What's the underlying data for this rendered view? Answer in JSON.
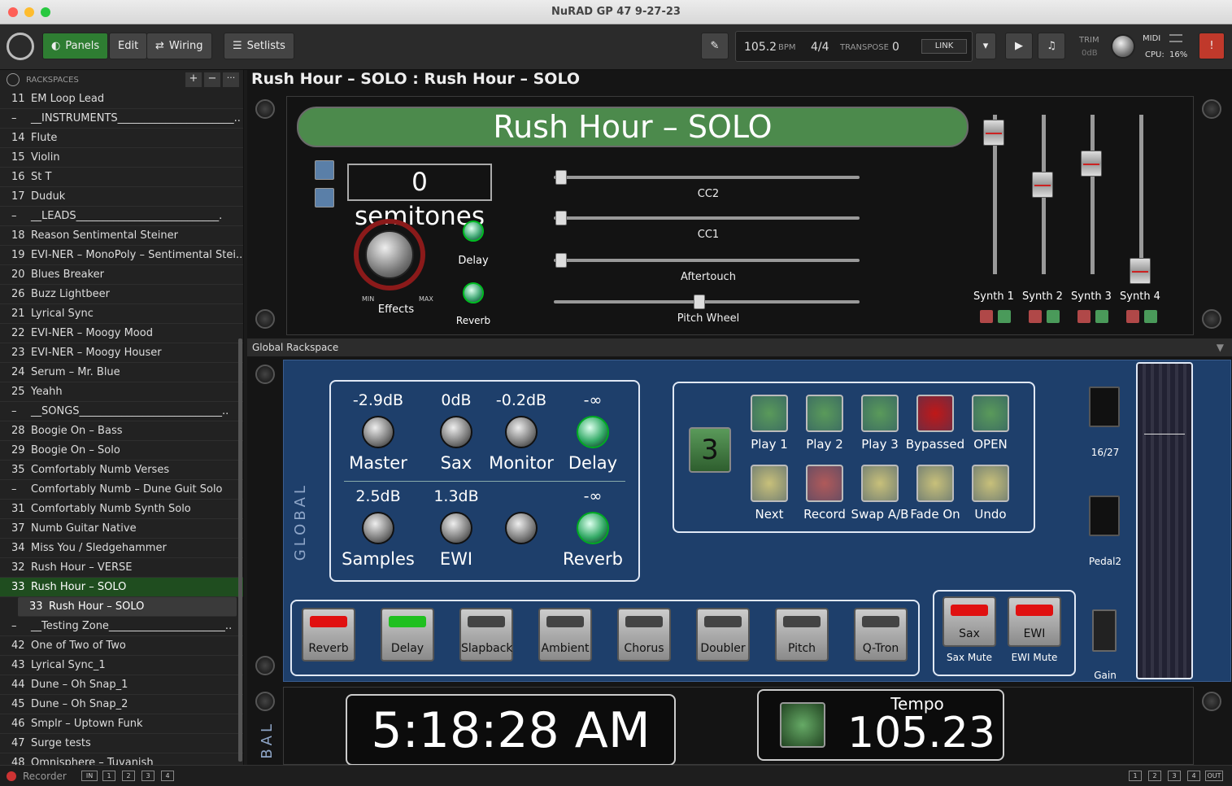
{
  "window": {
    "title": "NuRAD GP 47 9-27-23"
  },
  "toolbar": {
    "panels": "Panels",
    "edit": "Edit",
    "wiring": "Wiring",
    "setlists": "Setlists",
    "bpm_value": "105.2",
    "bpm_label": "BPM",
    "time_sig": "4/4",
    "transpose_label": "TRANSPOSE",
    "transpose_value": "0",
    "link": "LINK",
    "trim_label": "TRIM",
    "trim_value": "0dB",
    "midi_label": "MIDI",
    "cpu_label": "CPU:",
    "cpu_value": "16%"
  },
  "sidebar": {
    "header": "RACKSPACES",
    "items": [
      {
        "n": "11",
        "label": "EM Loop Lead"
      },
      {
        "n": "–",
        "label": "__INSTRUMENTS______________________.."
      },
      {
        "n": "14",
        "label": "Flute"
      },
      {
        "n": "15",
        "label": "Violin"
      },
      {
        "n": "16",
        "label": "St T"
      },
      {
        "n": "17",
        "label": "Duduk"
      },
      {
        "n": "–",
        "label": "__LEADS___________________________."
      },
      {
        "n": "18",
        "label": "Reason Sentimental Steiner"
      },
      {
        "n": "19",
        "label": "EVI-NER – MonoPoly – Sentimental Stei.."
      },
      {
        "n": "20",
        "label": "Blues Breaker"
      },
      {
        "n": "26",
        "label": "Buzz Lightbeer"
      },
      {
        "n": "21",
        "label": "Lyrical Sync"
      },
      {
        "n": "22",
        "label": "EVI-NER – Moogy Mood"
      },
      {
        "n": "23",
        "label": "EVI-NER – Moogy Houser"
      },
      {
        "n": "24",
        "label": "Serum – Mr. Blue"
      },
      {
        "n": "25",
        "label": "Yeahh"
      },
      {
        "n": "–",
        "label": "__SONGS___________________________.."
      },
      {
        "n": "28",
        "label": "Boogie On – Bass"
      },
      {
        "n": "29",
        "label": "Boogie On – Solo"
      },
      {
        "n": "35",
        "label": "Comfortably Numb Verses"
      },
      {
        "n": "–",
        "label": "Comfortably Numb – Dune Guit Solo"
      },
      {
        "n": "31",
        "label": "Comfortably Numb Synth Solo"
      },
      {
        "n": "37",
        "label": "Numb Guitar Native"
      },
      {
        "n": "34",
        "label": "Miss You / Sledgehammer"
      },
      {
        "n": "32",
        "label": "Rush Hour – VERSE"
      },
      {
        "n": "33",
        "label": "Rush Hour – SOLO"
      },
      {
        "n": "33",
        "label": "Rush Hour – SOLO"
      },
      {
        "n": "–",
        "label": "__Testing Zone______________________.."
      },
      {
        "n": "42",
        "label": "One of Two of Two"
      },
      {
        "n": "43",
        "label": "Lyrical Sync_1"
      },
      {
        "n": "44",
        "label": "Dune – Oh Snap_1"
      },
      {
        "n": "45",
        "label": "Dune – Oh Snap_2"
      },
      {
        "n": "46",
        "label": "Smplr – Uptown Funk"
      },
      {
        "n": "47",
        "label": "Surge tests"
      },
      {
        "n": "48",
        "label": "Omnisphere – Tuvanish"
      }
    ]
  },
  "rackspace": {
    "title": "Rush Hour – SOLO : Rush Hour – SOLO",
    "banner": "Rush Hour – SOLO",
    "semitones": "0 semitones",
    "effects": "Effects",
    "min": "MIN",
    "max": "MAX",
    "delay": "Delay",
    "reverb": "Reverb",
    "sliders": [
      "CC2",
      "CC1",
      "Aftertouch",
      "Pitch Wheel"
    ],
    "synths": [
      "Synth 1",
      "Synth 2",
      "Synth 3",
      "Synth 4"
    ]
  },
  "global": {
    "bar": "Global Rackspace",
    "vertical": "GLOBAL",
    "vertical2": "BAL",
    "mixer_top": [
      {
        "val": "-2.9dB",
        "label": "Master"
      },
      {
        "val": "0dB",
        "label": "Sax"
      },
      {
        "val": "-0.2dB",
        "label": "Monitor"
      },
      {
        "val": "-∞",
        "label": "Delay"
      }
    ],
    "mixer_bottom": [
      {
        "val": "2.5dB",
        "label": "Samples"
      },
      {
        "val": "1.3dB",
        "label": "EWI"
      },
      {
        "val": "",
        "label": ""
      },
      {
        "val": "-∞",
        "label": "Reverb"
      }
    ],
    "counter": "3",
    "pads_top": [
      "Play 1",
      "Play 2",
      "Play 3",
      "Bypassed",
      "OPEN"
    ],
    "pads_bottom": [
      "Next",
      "Record",
      "Swap A/B",
      "Fade On",
      "Undo"
    ],
    "fx": [
      "Reverb",
      "Delay",
      "Slapback",
      "Ambient",
      "Chorus",
      "Doubler",
      "Pitch",
      "Q-Tron"
    ],
    "mutes": [
      {
        "btn": "Sax",
        "label": "Sax Mute"
      },
      {
        "btn": "EWI",
        "label": "EWI Mute"
      }
    ],
    "side_labels": [
      "16/27",
      "Pedal2",
      "Gain"
    ],
    "clock": "5:18:28 AM",
    "tempo_label": "Tempo",
    "tempo_value": "105.23"
  },
  "statusbar": {
    "recorder": "Recorder",
    "in": "IN",
    "out": "OUT",
    "in_nums": [
      "1",
      "2",
      "3",
      "4"
    ],
    "out_nums": [
      "1",
      "2",
      "3",
      "4"
    ]
  },
  "colors": {
    "accent": "#2e7d32",
    "banner": "#4c8a4c",
    "global_bg": "#1e3f6b"
  }
}
